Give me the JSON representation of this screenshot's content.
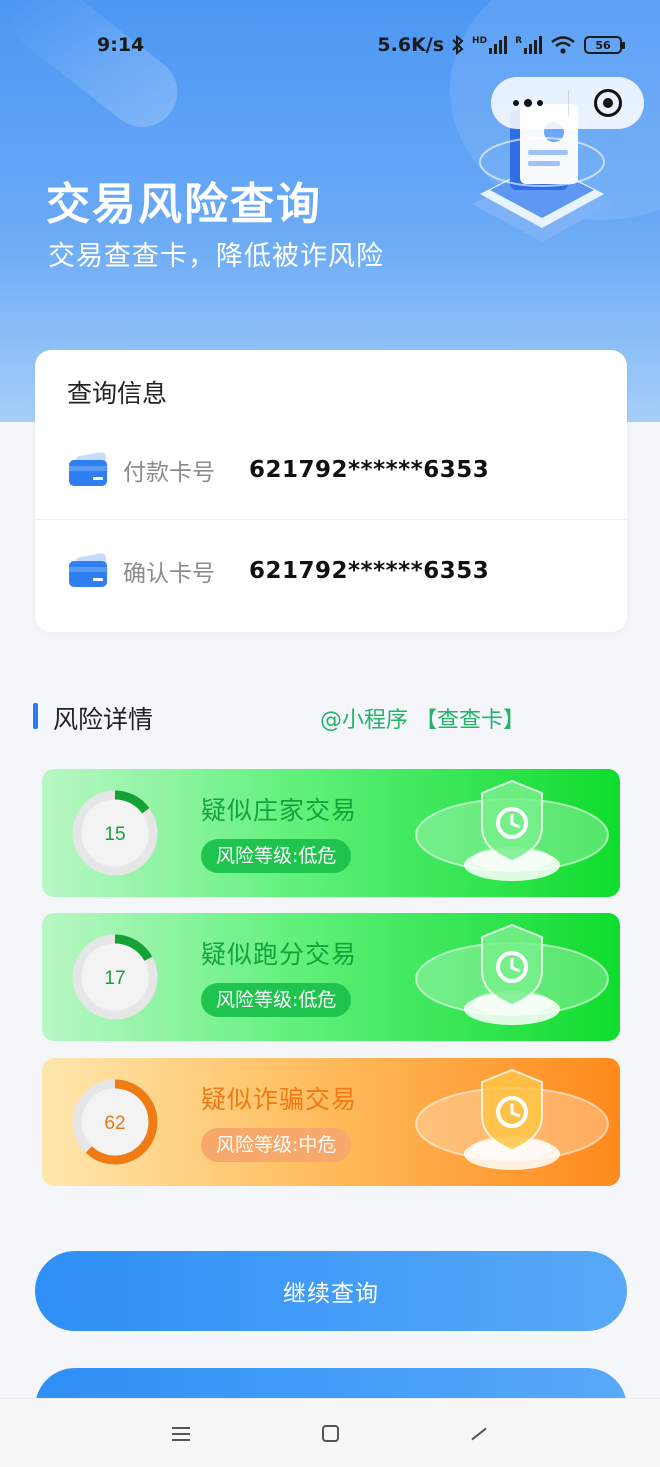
{
  "status_bar": {
    "time": "9:14",
    "speed": "5.6K/s",
    "bluetooth_icon": "bluetooth-icon",
    "hd_label": "HD",
    "r_label": "R",
    "battery": "56"
  },
  "capsule": {
    "more_icon": "more-dots-icon",
    "close_icon": "target-close-icon"
  },
  "hero": {
    "title": "交易风险查询",
    "subtitle": "交易查查卡，降低被诈风险"
  },
  "query_card": {
    "title": "查询信息",
    "rows": [
      {
        "label": "付款卡号",
        "value": "621792******6353",
        "icon": "bank-card-icon"
      },
      {
        "label": "确认卡号",
        "value": "621792******6353",
        "icon": "bank-card-icon"
      }
    ]
  },
  "risk_section": {
    "title": "风险详情",
    "link": "@小程序 【查查卡】",
    "items": [
      {
        "score": "15",
        "percent": 15,
        "title": "疑似庄家交易",
        "level": "风险等级:低危",
        "tone": "green"
      },
      {
        "score": "17",
        "percent": 17,
        "title": "疑似跑分交易",
        "level": "风险等级:低危",
        "tone": "green"
      },
      {
        "score": "62",
        "percent": 62,
        "title": "疑似诈骗交易",
        "level": "风险等级:中危",
        "tone": "orange"
      }
    ]
  },
  "buttons": {
    "continue": "继续查询",
    "second": ""
  },
  "colors": {
    "accent": "#2d7bf0",
    "green": "#16a23a",
    "orange": "#ef7a14"
  }
}
